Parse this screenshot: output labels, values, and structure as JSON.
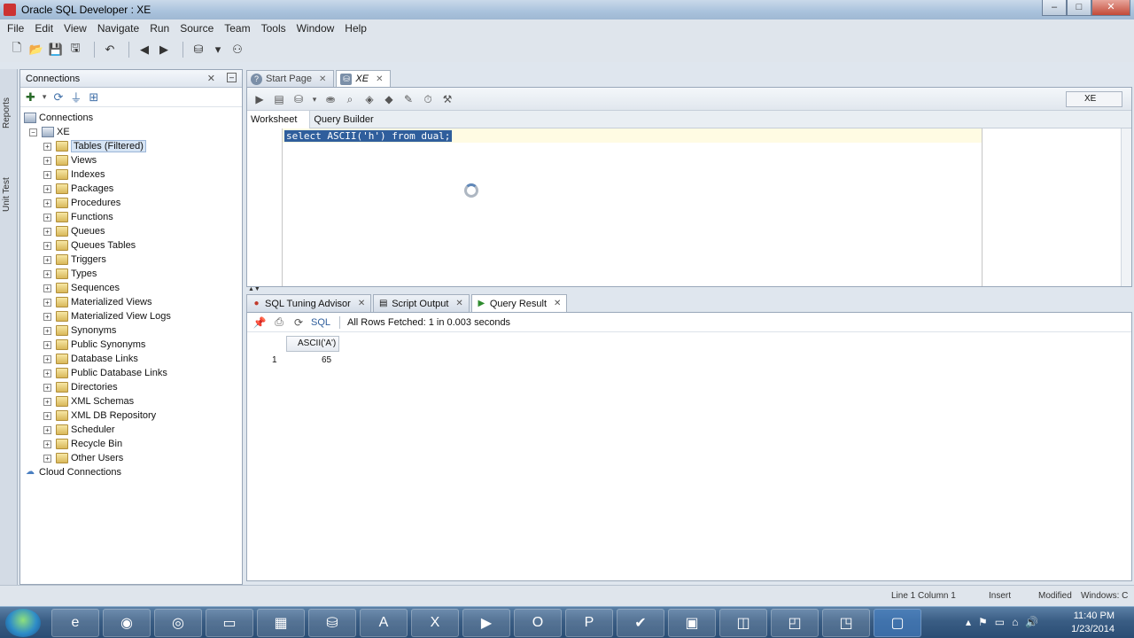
{
  "window": {
    "title": "Oracle SQL Developer : XE"
  },
  "menu": [
    "File",
    "Edit",
    "View",
    "Navigate",
    "Run",
    "Source",
    "Team",
    "Tools",
    "Window",
    "Help"
  ],
  "left_strip": {
    "reports": "Reports",
    "unit_test": "Unit Test"
  },
  "connections_panel": {
    "title": "Connections",
    "tree": {
      "root": "Connections",
      "connection": "XE",
      "items": [
        "Tables (Filtered)",
        "Views",
        "Indexes",
        "Packages",
        "Procedures",
        "Functions",
        "Queues",
        "Queues Tables",
        "Triggers",
        "Types",
        "Sequences",
        "Materialized Views",
        "Materialized View Logs",
        "Synonyms",
        "Public Synonyms",
        "Database Links",
        "Public Database Links",
        "Directories",
        "XML Schemas",
        "XML DB Repository",
        "Scheduler",
        "Recycle Bin",
        "Other Users"
      ],
      "cloud": "Cloud Connections"
    }
  },
  "editor": {
    "tabs": [
      {
        "label": "Start Page"
      },
      {
        "label": "XE"
      }
    ],
    "connection_selector": "XE",
    "subtabs": [
      "Worksheet",
      "Query Builder"
    ],
    "code": "select ASCII('h') from dual;"
  },
  "results": {
    "tabs": [
      {
        "label": "SQL Tuning Advisor"
      },
      {
        "label": "Script Output"
      },
      {
        "label": "Query Result"
      }
    ],
    "sql_link": "SQL",
    "status": "All Rows Fetched: 1 in 0.003 seconds",
    "column": "ASCII('A')",
    "row_num": "1",
    "value": "65"
  },
  "statusbar": {
    "position": "Line 1 Column 1",
    "mode": "Insert",
    "modified": "Modified",
    "os": "Windows: C"
  },
  "taskbar": {
    "time": "11:40 PM",
    "date": "1/23/2014"
  }
}
